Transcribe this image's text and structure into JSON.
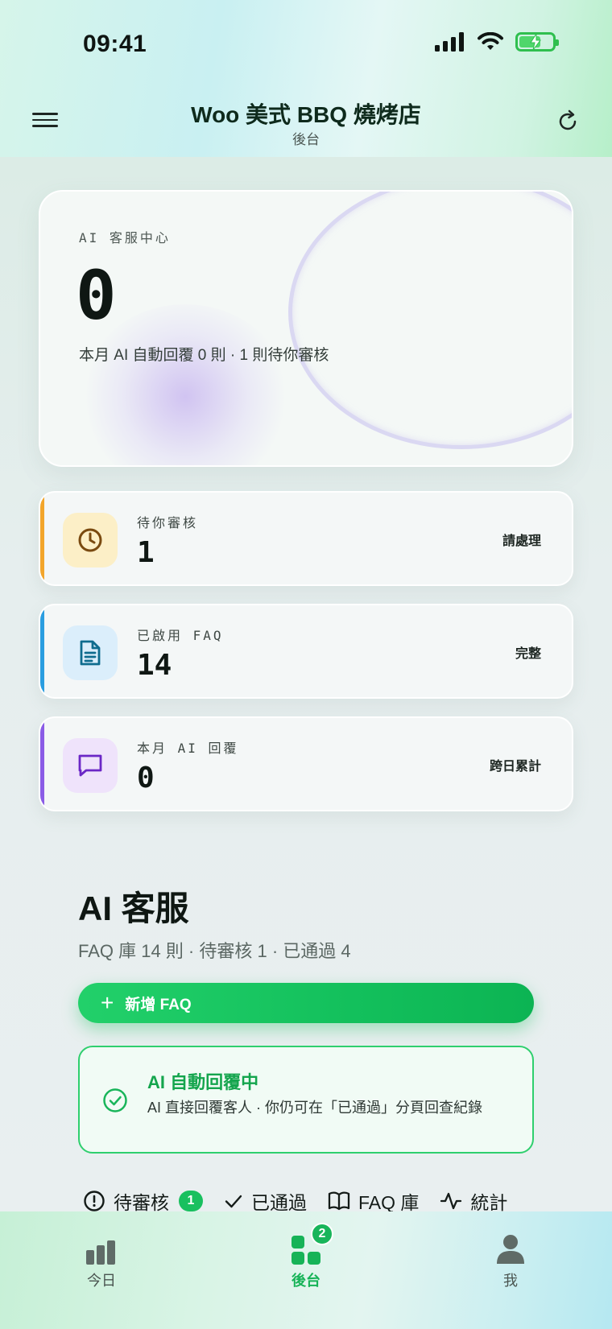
{
  "status_bar": {
    "time": "09:41"
  },
  "header": {
    "title": "Woo 美式 BBQ 燒烤店",
    "subtitle": "後台"
  },
  "hero": {
    "label": "AI 客服中心",
    "value": "0",
    "description": "本月 AI 自動回覆 0 則 · 1 則待你審核"
  },
  "stats": [
    {
      "label": "待你審核",
      "value": "1",
      "action": "請處理",
      "accent": "#f2a52b",
      "icon": "clock-icon"
    },
    {
      "label": "已啟用 FAQ",
      "value": "14",
      "action": "完整",
      "accent": "#2a9de0",
      "icon": "document-icon"
    },
    {
      "label": "本月 AI 回覆",
      "value": "0",
      "action": "跨日累計",
      "accent": "#8a5ce6",
      "icon": "chat-icon"
    }
  ],
  "ai_section": {
    "title": "AI 客服",
    "subtitle": "FAQ 庫 14 則 · 待審核 1 · 已通過 4",
    "add_button": "新增 FAQ",
    "auto_reply": {
      "title": "AI 自動回覆中",
      "description": "AI 直接回覆客人 · 你仍可在「已通過」分頁回查紀錄"
    },
    "tabs": [
      {
        "label": "待審核",
        "badge": "1",
        "icon": "alert-circle-icon"
      },
      {
        "label": "已通過",
        "icon": "check-icon"
      },
      {
        "label": "FAQ 庫",
        "icon": "book-icon"
      },
      {
        "label": "統計",
        "icon": "activity-icon"
      }
    ]
  },
  "bottom_nav": [
    {
      "label": "今日",
      "icon": "bar-chart-icon",
      "active": false
    },
    {
      "label": "後台",
      "icon": "grid-icon",
      "active": true,
      "badge": "2"
    },
    {
      "label": "我",
      "icon": "person-icon",
      "active": false
    }
  ],
  "colors": {
    "brand_green": "#19c05f",
    "auto_reply_text": "#14a54d",
    "pending_accent": "#f2a52b",
    "faq_accent": "#2a9de0",
    "ai_reply_accent": "#8a5ce6"
  }
}
